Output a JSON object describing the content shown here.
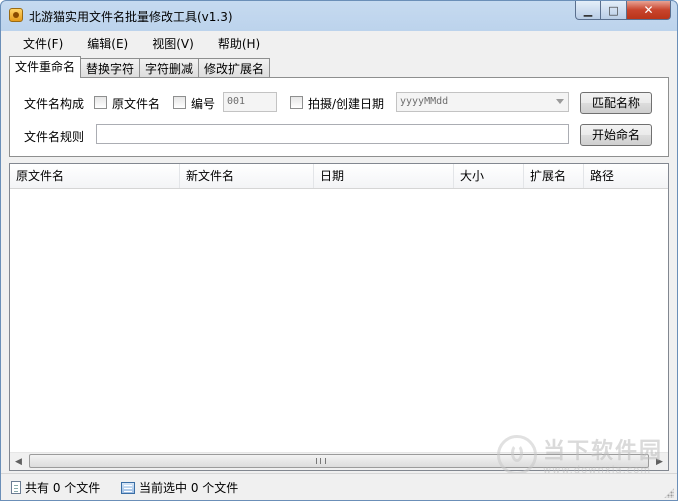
{
  "window": {
    "title": "北游猫实用文件名批量修改工具(v1.3)"
  },
  "window_buttons": {
    "minimize": "▁",
    "maximize": "□",
    "close": "✕"
  },
  "menu": [
    {
      "label": "文件(F)"
    },
    {
      "label": "编辑(E)"
    },
    {
      "label": "视图(V)"
    },
    {
      "label": "帮助(H)"
    }
  ],
  "tabs": [
    {
      "label": "文件重命名",
      "active": true
    },
    {
      "label": "替换字符"
    },
    {
      "label": "字符删减"
    },
    {
      "label": "修改扩展名"
    }
  ],
  "rename": {
    "compose_label": "文件名构成",
    "orig_name_label": "原文件名",
    "orig_name_checked": false,
    "number_label": "编号",
    "number_checked": false,
    "number_value": "001",
    "date_label": "拍摄/创建日期",
    "date_checked": false,
    "date_format": "yyyyMMdd",
    "match_button": "匹配名称",
    "rule_label": "文件名规则",
    "rule_value": "",
    "start_button": "开始命名"
  },
  "table": {
    "columns": [
      "原文件名",
      "新文件名",
      "日期",
      "大小",
      "扩展名",
      "路径"
    ],
    "rows": []
  },
  "scroll": {
    "left": "◀",
    "right": "▶"
  },
  "status": {
    "total": "共有 0 个文件",
    "selected": "当前选中 0 个文件"
  },
  "watermark": {
    "main": "当下软件园",
    "sub": "www.downxia.com"
  }
}
